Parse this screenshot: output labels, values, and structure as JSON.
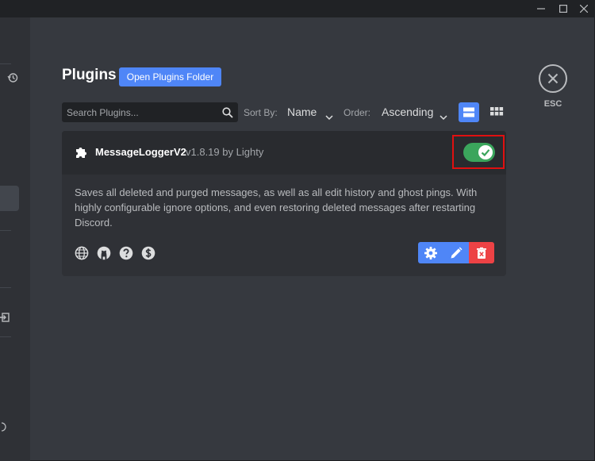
{
  "window": {
    "controls": {
      "minimize": "minimize-icon",
      "maximize": "maximize-icon",
      "close": "close-icon"
    }
  },
  "sidebar": {
    "icons": [
      "history-icon",
      "logout-icon",
      "info-icon"
    ]
  },
  "header": {
    "title": "Plugins",
    "open_folder_label": "Open Plugins Folder"
  },
  "toolbar": {
    "search_placeholder": "Search Plugins...",
    "sort_label": "Sort By:",
    "sort_value": "Name",
    "order_label": "Order:",
    "order_value": "Ascending",
    "view_modes": [
      "list",
      "grid"
    ],
    "active_view": "list"
  },
  "esc": {
    "label": "ESC"
  },
  "plugin": {
    "name": "MessageLoggerV2",
    "version": "v1.8.19",
    "by": "by",
    "author": "Lighty",
    "enabled": true,
    "description": "Saves all deleted and purged messages, as well as all edit history and ghost pings. With highly configurable ignore options, and even restoring deleted messages after restarting Discord.",
    "links": [
      "globe-icon",
      "github-icon",
      "help-icon",
      "donate-icon"
    ],
    "actions": [
      "settings",
      "edit",
      "delete"
    ]
  },
  "colors": {
    "background": "#36393f",
    "card": "#2f3136",
    "card_header": "#292b2f",
    "accent": "#4f86f7",
    "toggle_on": "#3ba55c",
    "danger": "#ed4245",
    "highlight": "#e01010"
  }
}
